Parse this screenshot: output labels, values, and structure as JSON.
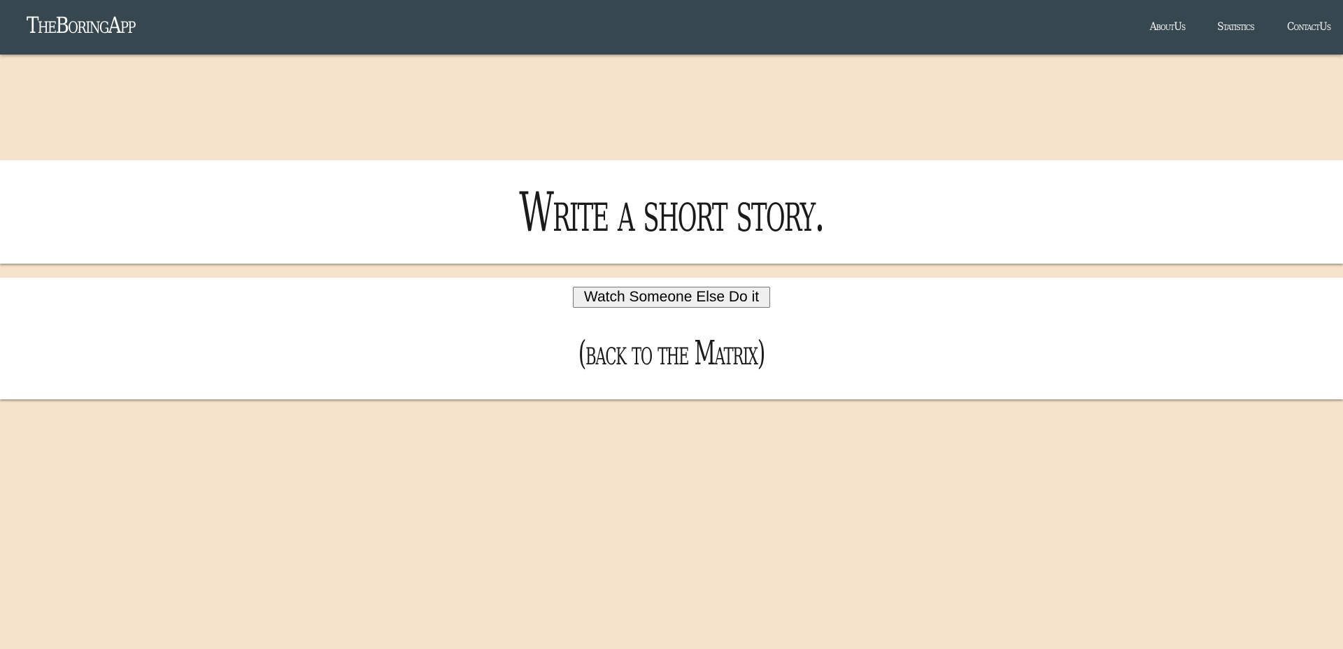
{
  "navbar": {
    "brand": "TheBoringApp",
    "links": [
      "AboutUs",
      "Statistics",
      "ContactUs"
    ]
  },
  "prompt": {
    "text": "Write a short story."
  },
  "actions": {
    "watch_button": "Watch Someone Else Do it",
    "back_link": "(back to the Matrix)"
  },
  "colors": {
    "navbar_bg": "#37474f",
    "page_bg": "#f6e3cc",
    "card_bg": "#ffffff"
  }
}
